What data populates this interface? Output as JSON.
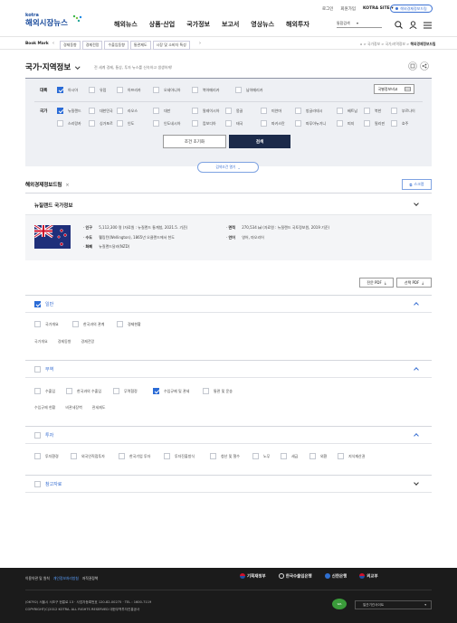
{
  "header": {
    "logo_small": "kotra",
    "logo_main": "해외시장뉴스",
    "util": [
      "로그인",
      "회원가입",
      "KOTRA SITE"
    ],
    "util_pill": "해외경제정보드림",
    "nav": [
      "해외뉴스",
      "상품·산업",
      "국가정보",
      "보고서",
      "영상뉴스",
      "해외투자"
    ],
    "search_label": "통합검색"
  },
  "bookmark": {
    "label": "Book Mark",
    "items": [
      "경제동향",
      "경제전망",
      "수출입동향",
      "통관제도",
      "시장 및 소비자 특성"
    ],
    "breadcrumb": [
      "국가정보",
      "국가/지역정보"
    ],
    "crumb_current": "해외경제정보드림"
  },
  "page": {
    "title": "국가·지역정보",
    "subtitle": "전 세계 경제, 통상, 투자 뉴스를 신속하고 생생하게!"
  },
  "filter": {
    "region_label": "대륙",
    "regions": [
      "아시아",
      "유럽",
      "아프리카",
      "오세아니아",
      "북아메리카",
      "남아메리카"
    ],
    "compare_btn": "국별정보비교",
    "country_label": "국가",
    "countries_row1": [
      "뉴질랜드",
      "대한민국",
      "라오스",
      "대만",
      "말레이시아",
      "몽골",
      "미얀마",
      "방글라데시",
      "베트남",
      "북한",
      "부르나이"
    ],
    "countries_row2": [
      "스리랑카",
      "싱가포르",
      "인도",
      "인도네시아",
      "캄보디아",
      "태국",
      "파키스탄",
      "파푸아뉴기니",
      "피지",
      "필리핀",
      "호주"
    ],
    "reset_btn": "조건 초기화",
    "search_btn": "검색",
    "expand_btn": "검색조건 열기"
  },
  "dream": {
    "title": "해외경제정보드림",
    "scrap": "스크랩"
  },
  "country": {
    "title": "뉴질랜드 국가정보",
    "facts_left": [
      {
        "k": "인구",
        "v": "5,112,300 명 (자료원 : 뉴질랜드 통계청, 2021.5. 기준)"
      },
      {
        "k": "수도",
        "v": "웰링턴(Wellington), 1865년 오클랜드에서 천도"
      },
      {
        "k": "화폐",
        "v": "뉴질랜드달러(NZD)"
      }
    ],
    "facts_right": [
      {
        "k": "면적",
        "v": "270,534 ㎢ (자료원 : 뉴질랜드 국토정보원, 2019 기준)"
      },
      {
        "k": "언어",
        "v": "영어, 마오리어"
      }
    ]
  },
  "pdf": {
    "all": "전문 PDF",
    "select": "선택 PDF"
  },
  "sections": {
    "general": {
      "title": "일반",
      "opts": [
        "국가개요",
        "한국과의 관계",
        "경제현황"
      ],
      "links": [
        "국가개요",
        "경제동향",
        "경제전망"
      ]
    },
    "trade": {
      "title": "무역",
      "opts": [
        "수출입",
        "한국과의 수출입",
        "무역협정",
        "수입규제 및 관세",
        "통관 및 운송"
      ],
      "links": [
        "수입규제 현황",
        "비관세장벽",
        "관세제도"
      ]
    },
    "invest": {
      "title": "투자",
      "opts": [
        "투자환경",
        "외국인직접투자",
        "한국기업 투자",
        "투자진출방식",
        "청산 및 철수",
        "노무",
        "세금",
        "외환",
        "지식재산권"
      ]
    },
    "ref": {
      "title": "참고자료"
    }
  },
  "footer": {
    "links": [
      "이용약관 및 원칙",
      "개인정보처리방침",
      "저작권정책"
    ],
    "partners": [
      "기획재정부",
      "한국수출입은행",
      "신한은행",
      "외교부"
    ],
    "addr": "(06792) 서울시 서초구 헌릉로 13 · 사업자등록번호 120-82-00275 · TEL : 1600-7119",
    "copy": "COPYRIGHT(C)2012 KOTRA. ALL RIGHTS RESERVED 대한무역투자진흥공사",
    "family": "일관기관사이트"
  },
  "colors": {
    "accent": "#2a6bd6",
    "navy": "#1b2a4a",
    "footer": "#1b1b1b"
  }
}
